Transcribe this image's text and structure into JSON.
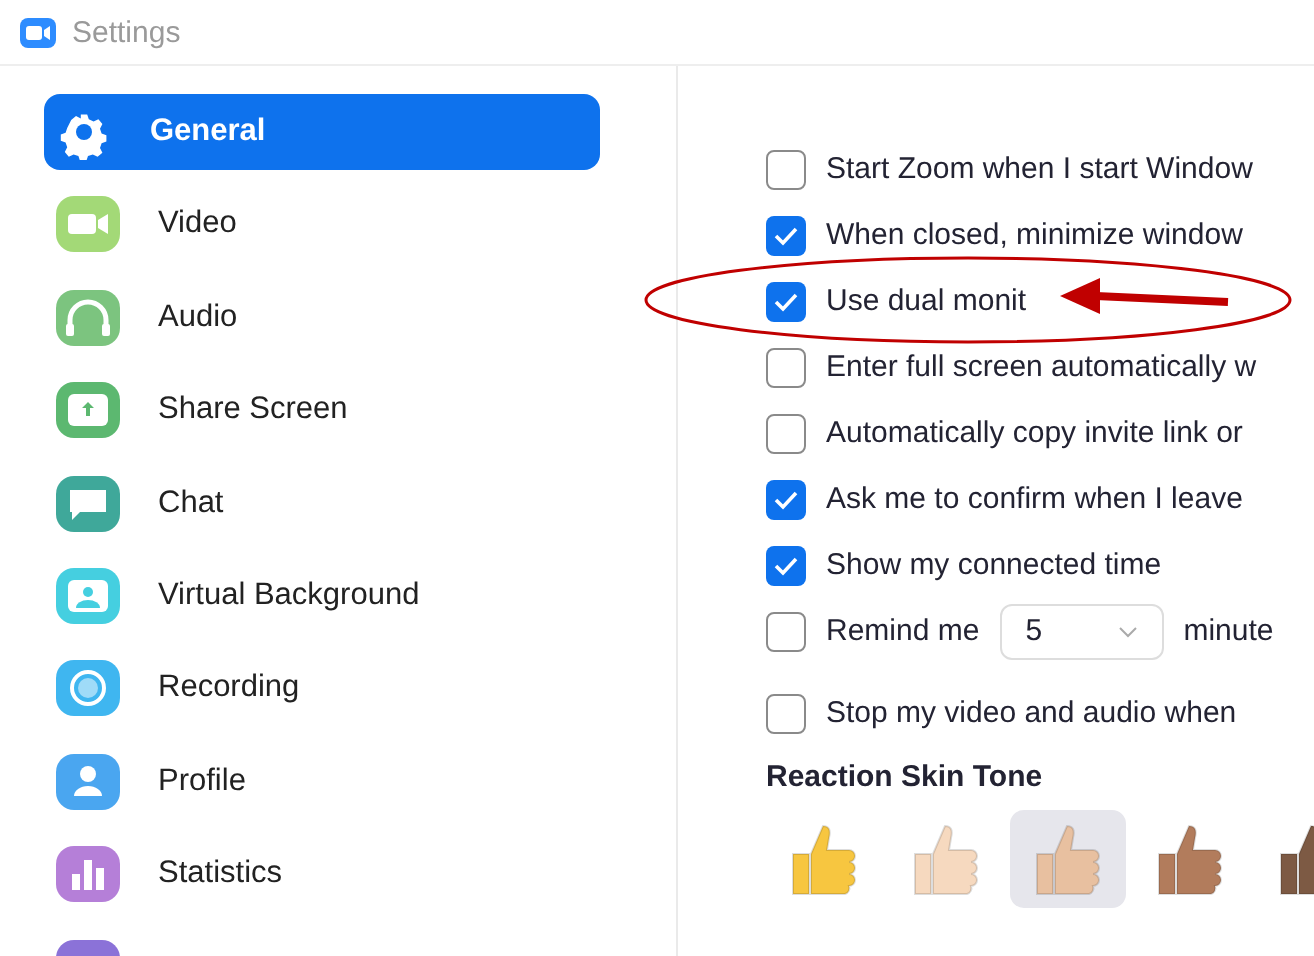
{
  "window": {
    "title": "Settings"
  },
  "sidebar": {
    "items": [
      {
        "label": "General",
        "selected": true,
        "color": "#ffffff"
      },
      {
        "label": "Video",
        "selected": false,
        "color": "#a3d977"
      },
      {
        "label": "Audio",
        "selected": false,
        "color": "#7cc47f"
      },
      {
        "label": "Share Screen",
        "selected": false,
        "color": "#5cb870"
      },
      {
        "label": "Chat",
        "selected": false,
        "color": "#3fa89a"
      },
      {
        "label": "Virtual Background",
        "selected": false,
        "color": "#45cfe0"
      },
      {
        "label": "Recording",
        "selected": false,
        "color": "#3fb6f0"
      },
      {
        "label": "Profile",
        "selected": false,
        "color": "#4aa6f0"
      },
      {
        "label": "Statistics",
        "selected": false,
        "color": "#b57fd8"
      },
      {
        "selected": false,
        "color": "#8b72d8"
      }
    ]
  },
  "options": [
    {
      "kind": "checkbox",
      "label": "Start Zoom when I start Window",
      "checked": false
    },
    {
      "kind": "checkbox",
      "label": "When closed, minimize window",
      "checked": true
    },
    {
      "kind": "checkbox",
      "label": "Use dual monit",
      "checked": true
    },
    {
      "kind": "checkbox",
      "label": "Enter full screen automatically w",
      "checked": false
    },
    {
      "kind": "checkbox",
      "label": "Automatically copy invite link or",
      "checked": false
    },
    {
      "kind": "checkbox",
      "label": "Ask me to confirm when I leave",
      "checked": true
    },
    {
      "kind": "checkbox",
      "label": "Show my connected time",
      "checked": true
    },
    {
      "kind": "reminder",
      "label": "Remind me",
      "checked": false,
      "value": "5",
      "suffix": "minute"
    },
    {
      "kind": "checkbox",
      "label": "Stop my video and audio when",
      "checked": false
    }
  ],
  "skin_tone": {
    "title": "Reaction Skin Tone",
    "tones": [
      {
        "color": "#f7c640",
        "selected": false
      },
      {
        "color": "#f6d9bf",
        "selected": false
      },
      {
        "color": "#e8c0a0",
        "selected": true
      },
      {
        "color": "#b27c5c",
        "selected": false
      },
      {
        "color": "#7d5a44",
        "selected": false
      }
    ]
  }
}
